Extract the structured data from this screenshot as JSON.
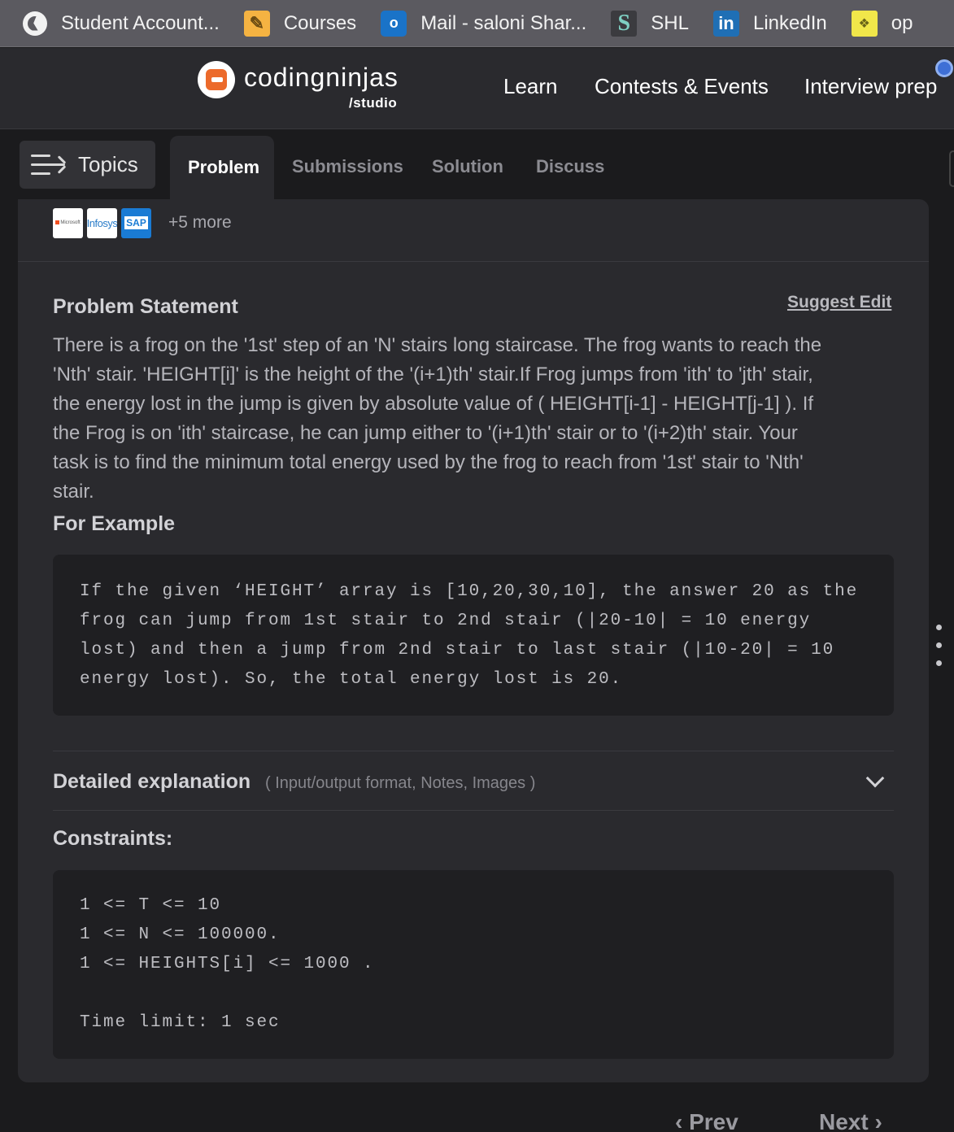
{
  "bookmarks": [
    {
      "label": "Student Account...",
      "icon": "globe-icon"
    },
    {
      "label": "Courses",
      "icon": "pencil-icon"
    },
    {
      "label": "Mail - saloni Shar...",
      "icon": "outlook-icon"
    },
    {
      "label": "SHL",
      "icon": "shl-icon"
    },
    {
      "label": "LinkedIn",
      "icon": "linkedin-icon"
    },
    {
      "label": "op",
      "icon": "op-icon"
    }
  ],
  "header": {
    "logo_main": "codingninjas",
    "logo_sub": "/studio",
    "nav": [
      "Learn",
      "Contests & Events",
      "Interview prep"
    ]
  },
  "tabs": {
    "topics": "Topics",
    "items": [
      "Problem",
      "Submissions",
      "Solution",
      "Discuss"
    ],
    "active": "Problem"
  },
  "companies": {
    "logos": [
      "Microsoft",
      "Infosys",
      "SAP"
    ],
    "more": "+5 more"
  },
  "problem": {
    "heading": "Problem Statement",
    "suggest_edit": "Suggest Edit",
    "statement_lines": [
      "There is a frog on the '1st' step of an 'N' stairs long staircase. The frog wants to reach the",
      "'Nth' stair. 'HEIGHT[i]' is the height of the '(i+1)th' stair.If Frog jumps from 'ith' to 'jth' stair,",
      "the energy lost in the jump is given by absolute value of ( HEIGHT[i-1] - HEIGHT[j-1] ). If",
      "the Frog is on 'ith' staircase, he can jump either to '(i+1)th' stair or to '(i+2)th' stair. Your",
      "task is to find the minimum total energy used by the frog to reach from '1st' stair to 'Nth'",
      "stair."
    ],
    "example_heading": "For Example",
    "example_lines": [
      "If the given ‘HEIGHT’ array is [10,20,30,10], the answer 20 as the",
      "frog can jump from 1st stair to 2nd stair (|20-10| = 10 energy",
      "lost) and then a jump from 2nd stair to last stair (|10-20| = 10",
      "energy lost). So, the total energy lost is 20."
    ],
    "detailed_title": "Detailed explanation",
    "detailed_sub": "( Input/output format, Notes, Images )",
    "constraints_heading": "Constraints:",
    "constraints_lines": [
      "1 <= T <= 10",
      "1 <= N <= 100000.",
      "1 <= HEIGHTS[i] <= 1000 .",
      "",
      "Time limit: 1 sec"
    ]
  },
  "pager": {
    "prev": "Prev",
    "next": "Next"
  },
  "colors": {
    "accent": "#ec6a2b",
    "background": "#1b1b1d",
    "card": "#2a2a2e"
  }
}
